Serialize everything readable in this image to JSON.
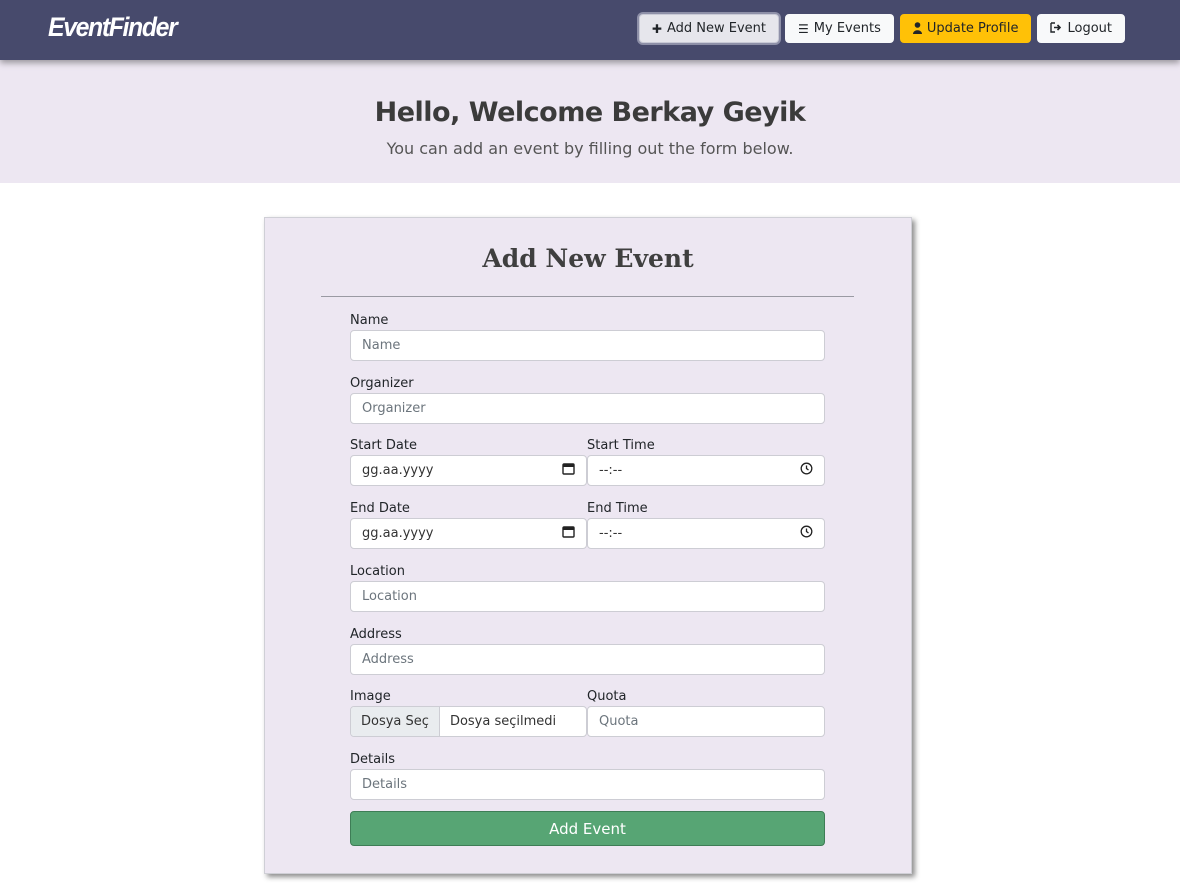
{
  "nav": {
    "brand": "EventFinder",
    "buttons": [
      {
        "label": "Add New Event",
        "icon": "plus-icon"
      },
      {
        "label": "My Events",
        "icon": "list-icon"
      },
      {
        "label": "Update Profile",
        "icon": "user-icon"
      },
      {
        "label": "Logout",
        "icon": "sign-out-icon"
      }
    ]
  },
  "hero": {
    "title": "Hello, Welcome Berkay Geyik",
    "subtitle": "You can add an event by filling out the form below."
  },
  "form": {
    "title": "Add New Event",
    "name": {
      "label": "Name",
      "placeholder": "Name"
    },
    "organizer": {
      "label": "Organizer",
      "placeholder": "Organizer"
    },
    "start_date": {
      "label": "Start Date",
      "value": "gg.aa.yyyy"
    },
    "start_time": {
      "label": "Start Time",
      "value": "--:--"
    },
    "end_date": {
      "label": "End Date",
      "value": "gg.aa.yyyy"
    },
    "end_time": {
      "label": "End Time",
      "value": "--:--"
    },
    "location": {
      "label": "Location",
      "placeholder": "Location"
    },
    "address": {
      "label": "Address",
      "placeholder": "Address"
    },
    "image": {
      "label": "Image",
      "button": "Dosya Seç",
      "status": "Dosya seçilmedi"
    },
    "quota": {
      "label": "Quota",
      "placeholder": "Quota"
    },
    "details": {
      "label": "Details",
      "placeholder": "Details"
    },
    "submit": "Add Event"
  },
  "colors": {
    "navbar": "#474a6c",
    "hero_bg": "#ede7f2",
    "warning": "#ffc107",
    "success": "#57a574"
  }
}
